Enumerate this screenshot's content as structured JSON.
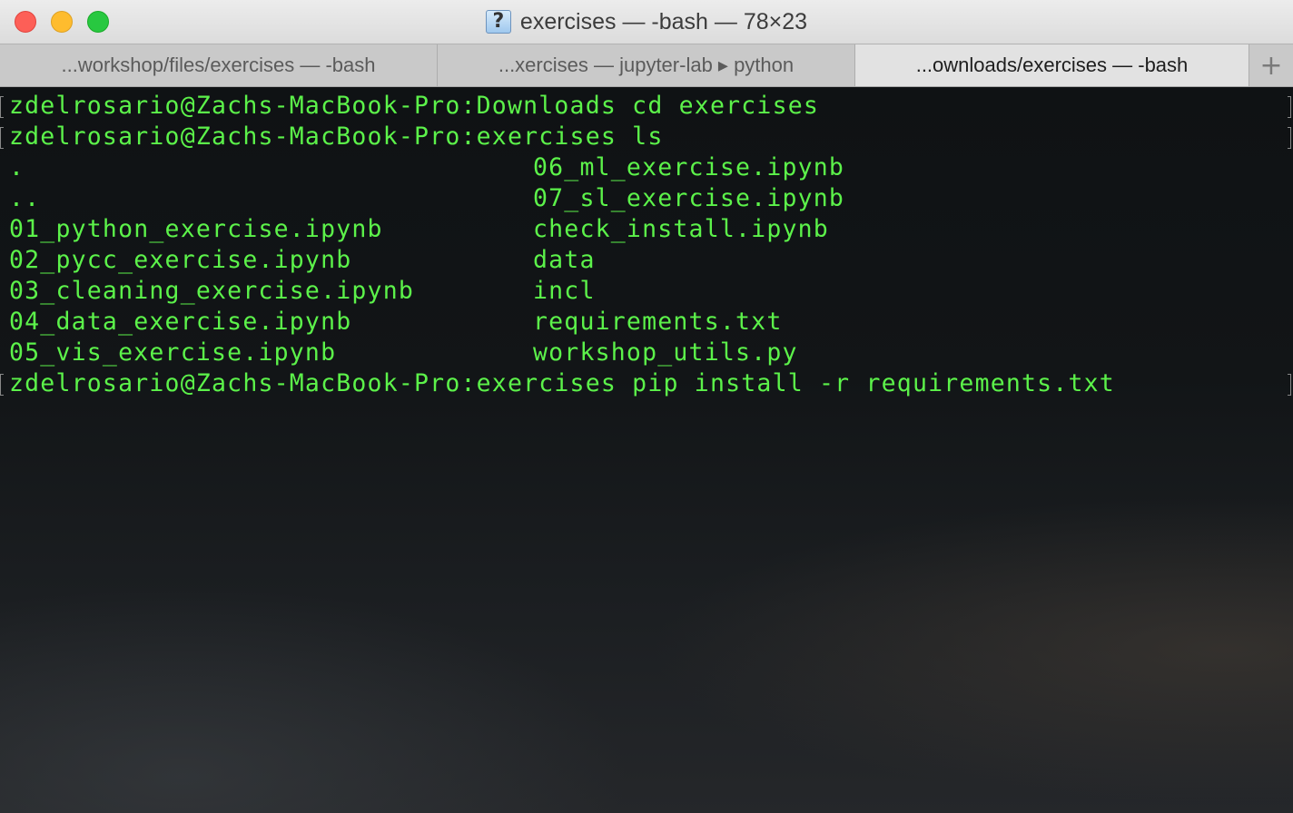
{
  "window": {
    "title": "exercises — -bash — 78×23",
    "proxy_icon": "?"
  },
  "tabs": [
    {
      "label": "...workshop/files/exercises — -bash",
      "active": false
    },
    {
      "label": "...xercises — jupyter-lab ▸ python",
      "active": false
    },
    {
      "label": "...ownloads/exercises — -bash",
      "active": true
    }
  ],
  "new_tab_label": "+",
  "terminal": {
    "text_color": "#5cf24a",
    "prompts": [
      "zdelrosario@Zachs-MacBook-Pro:Downloads cd exercises",
      "zdelrosario@Zachs-MacBook-Pro:exercises ls",
      "zdelrosario@Zachs-MacBook-Pro:exercises pip install -r requirements.txt"
    ],
    "listing_left": [
      ".",
      "..",
      "01_python_exercise.ipynb",
      "02_pycc_exercise.ipynb",
      "03_cleaning_exercise.ipynb",
      "04_data_exercise.ipynb",
      "05_vis_exercise.ipynb"
    ],
    "listing_right": [
      "06_ml_exercise.ipynb",
      "07_sl_exercise.ipynb",
      "check_install.ipynb",
      "data",
      "incl",
      "requirements.txt",
      "workshop_utils.py"
    ]
  }
}
